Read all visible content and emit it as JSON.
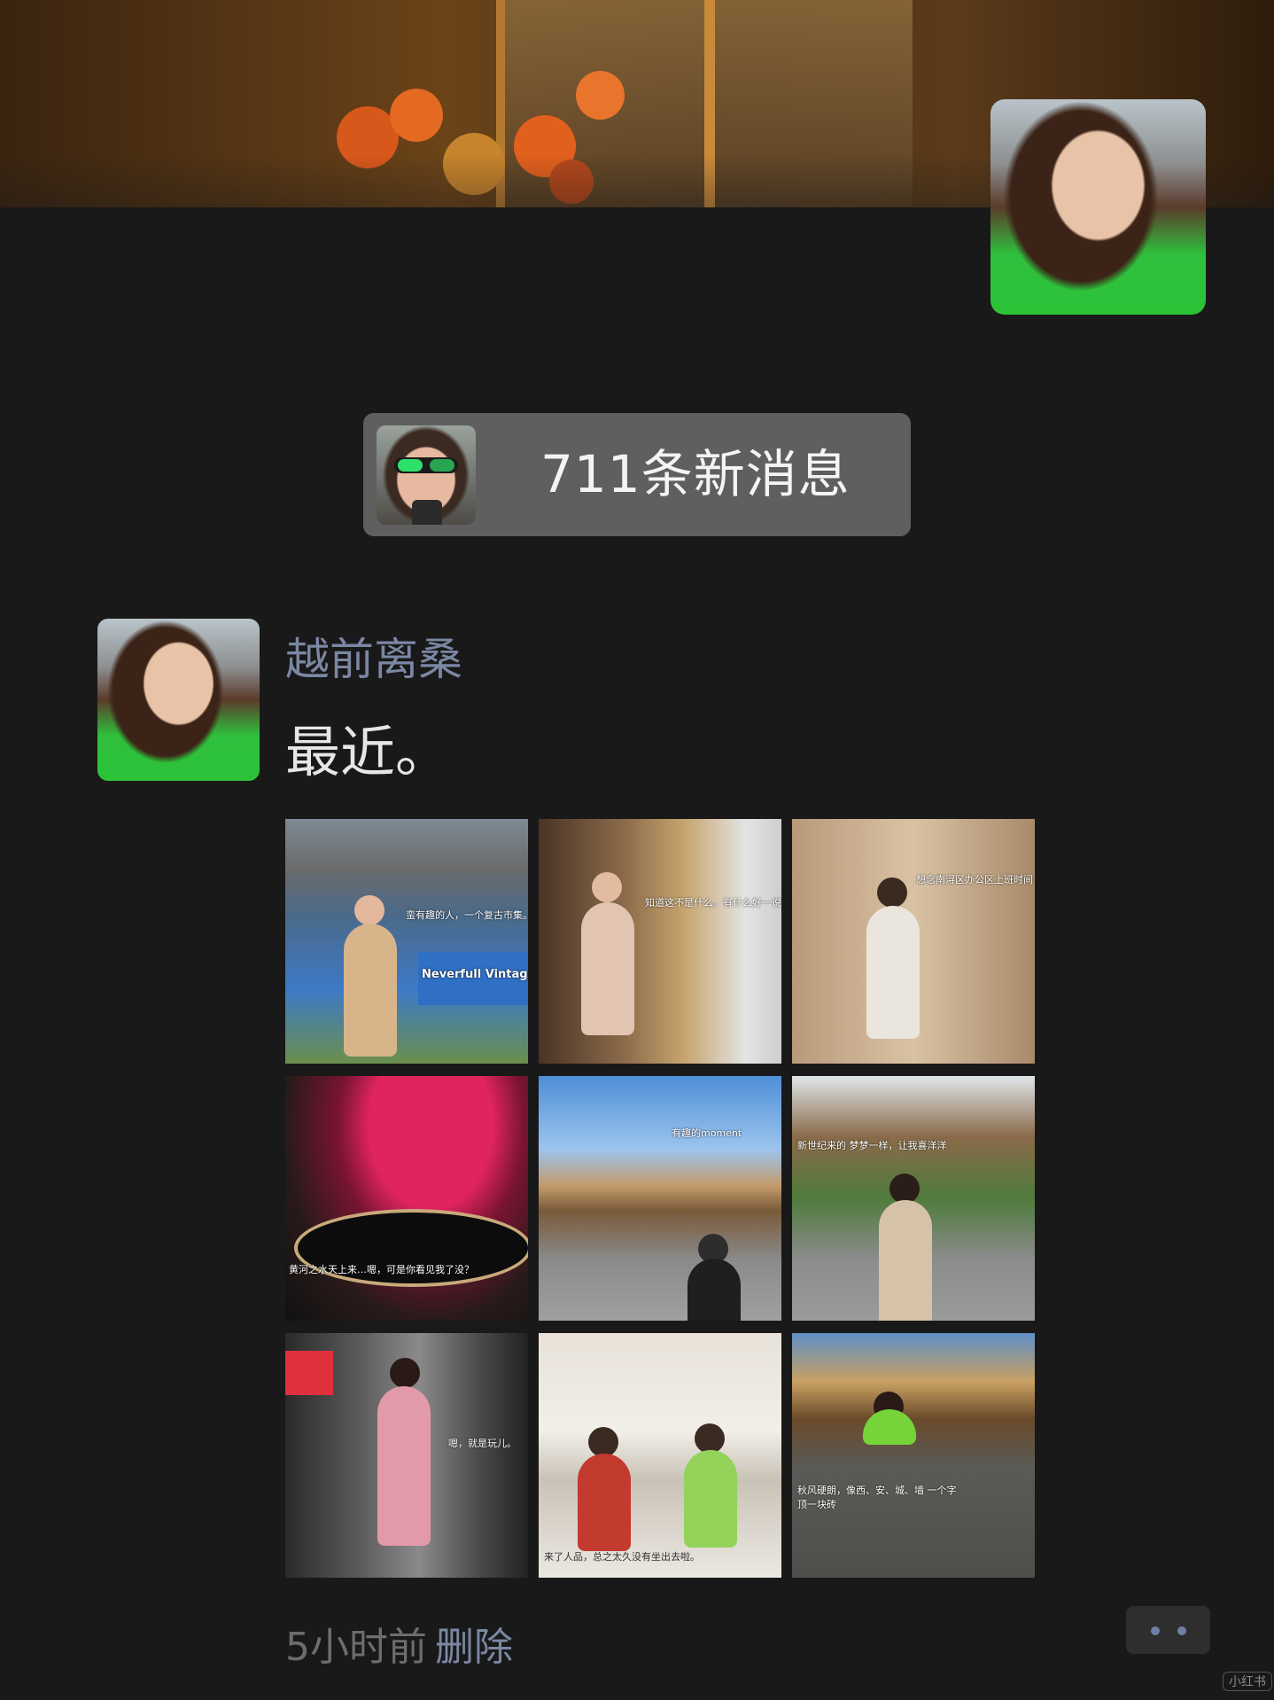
{
  "feed": {
    "new_messages_label": "711条新消息",
    "post": {
      "author": "越前离桑",
      "content": "最近。",
      "time": "5小时前",
      "delete_label": "删除",
      "photos": [
        {
          "caption": "蛮有趣的人，一个复古市集。",
          "sign": "Neverfull Vintage"
        },
        {
          "caption": "知道这不是什么。有什么好一说"
        },
        {
          "caption": "想念南浔区办公区上班时间"
        },
        {
          "caption": "黄河之水天上来…嗯，可是你看见我了没？"
        },
        {
          "caption": "有趣的moment"
        },
        {
          "caption": "新世纪来的 梦梦一样，让我喜洋洋"
        },
        {
          "caption": "嗯，就是玩儿。"
        },
        {
          "caption": "来了人品，总之太久没有坐出去啦。"
        },
        {
          "caption": "秋风硬朗，像西、安、城、墙 一个字顶一块砖"
        }
      ]
    }
  },
  "watermark": "小红书"
}
